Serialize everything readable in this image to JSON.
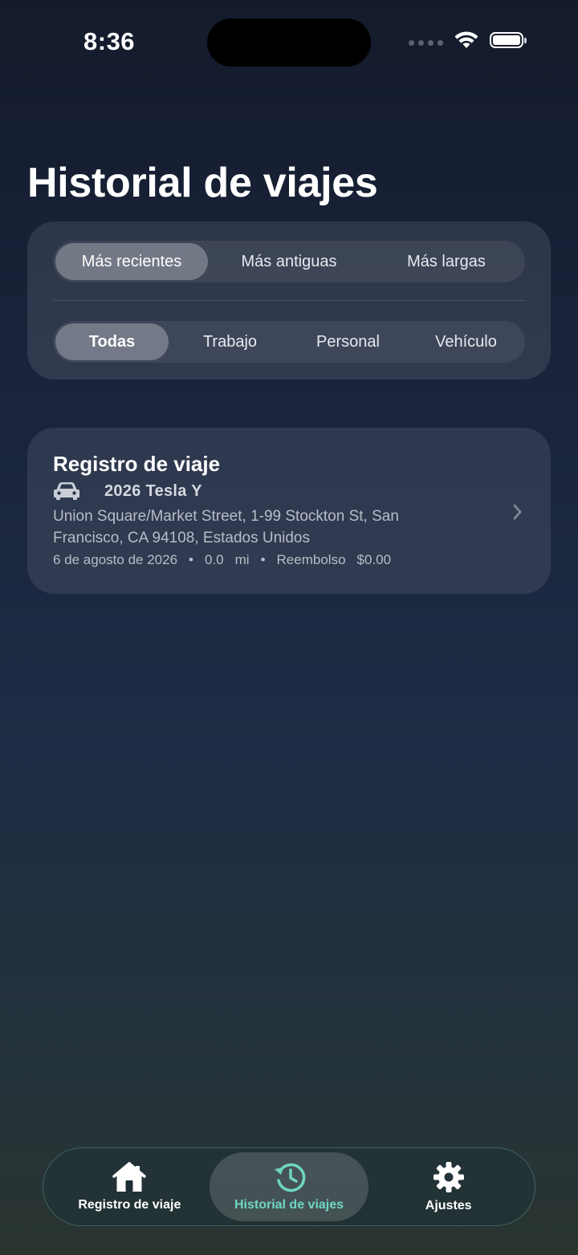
{
  "status_bar": {
    "time": "8:36",
    "icons": [
      "cellular-dots-icon",
      "wifi-icon",
      "battery-icon"
    ]
  },
  "page_title": "Historial de viajes",
  "filters": {
    "sort": {
      "options": [
        "Más recientes",
        "Más antiguas",
        "Más largas"
      ],
      "selected": "Más recientes"
    },
    "category": {
      "options": [
        "Todas",
        "Trabajo",
        "Personal",
        "Vehículo"
      ],
      "selected": "Todas"
    }
  },
  "trips": [
    {
      "title": "Registro de viaje",
      "vehicle_icon": "car-icon",
      "vehicle": "2026 Tesla Y",
      "address": "Union Square/Market Street, 1-99 Stockton St, San Francisco, CA  94108, Estados Unidos",
      "date": "6 de agosto de 2026",
      "distance": "0.0",
      "distance_unit": "mi",
      "reimbursement_label": "Reembolso",
      "reimbursement": "$0.00"
    }
  ],
  "tabbar": {
    "tabs": [
      {
        "label": "Registro de viaje",
        "icon": "house-icon"
      },
      {
        "label": "Historial de viajes",
        "icon": "history-icon"
      },
      {
        "label": "Ajustes",
        "icon": "gear-icon"
      }
    ],
    "active": "Historial de viajes"
  },
  "colors": {
    "accent": "#6fd6c3",
    "background_top": "#141b2c",
    "background_bottom": "#2a3530"
  }
}
